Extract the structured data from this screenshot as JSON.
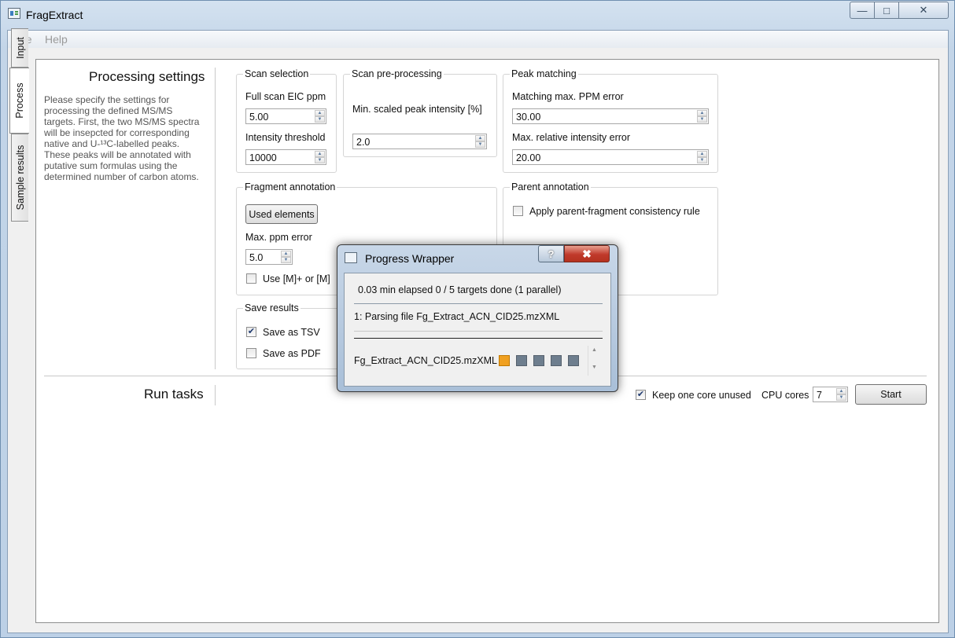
{
  "window": {
    "title": "FragExtract"
  },
  "menu": {
    "items": [
      "File",
      "Help"
    ]
  },
  "tabs": [
    "Input",
    "Process",
    "Sample results"
  ],
  "process": {
    "heading": "Processing settings",
    "description": "Please specify the settings for processing the defined MS/MS targets. First, the two MS/MS spectra will be insepcted for corresponding native and U-¹³C-labelled peaks. These peaks will be annotated with putative sum formulas using the determined number of carbon atoms.",
    "scan_selection": {
      "title": "Scan selection",
      "eic_label": "Full scan EIC ppm",
      "eic_value": "5.00",
      "intensity_label": "Intensity threshold",
      "intensity_value": "10000"
    },
    "scan_preprocessing": {
      "title": "Scan pre-processing",
      "min_label": "Min. scaled peak intensity [%]",
      "min_value": "2.0"
    },
    "peak_matching": {
      "title": "Peak matching",
      "ppm_label": "Matching max. PPM error",
      "ppm_value": "30.00",
      "rel_label": "Max. relative intensity error",
      "rel_value": "20.00"
    },
    "fragment_annotation": {
      "title": "Fragment annotation",
      "used_elements": "Used elements",
      "ppm_label": "Max. ppm error",
      "ppm_value": "5.0",
      "use_label": "Use [M]+ or [M]",
      "use_checked": false
    },
    "parent_annotation": {
      "title": "Parent annotation",
      "rule_label": "Apply parent-fragment consistency rule",
      "rule_checked": false
    },
    "save_results": {
      "title": "Save results",
      "tsv_label": "Save as TSV",
      "tsv_checked": true,
      "pdf_label": "Save as PDF",
      "pdf_checked": false
    }
  },
  "run": {
    "heading": "Run tasks",
    "keep_core_label": "Keep one core unused",
    "keep_core_checked": true,
    "cpu_label": "CPU cores",
    "cpu_value": "7",
    "start_label": "Start"
  },
  "progress_dialog": {
    "title": "Progress Wrapper",
    "help_glyph": "?",
    "close_glyph": "✖",
    "elapsed": "0.03 min elapsed 0 / 5 targets done (1 parallel)",
    "current_task": "1: Parsing file Fg_Extract_ACN_CID25.mzXML",
    "file_label": "Fg_Extract_ACN_CID25.mzXML",
    "status_colors": {
      "active": "#f0a020",
      "pending": "#6e7e8e"
    },
    "target_states": [
      "active",
      "pending",
      "pending",
      "pending",
      "pending"
    ]
  },
  "icons": {
    "minimize": "—",
    "maximize": "□",
    "close": "✕",
    "check": "✔",
    "up": "▲",
    "down": "▼"
  }
}
